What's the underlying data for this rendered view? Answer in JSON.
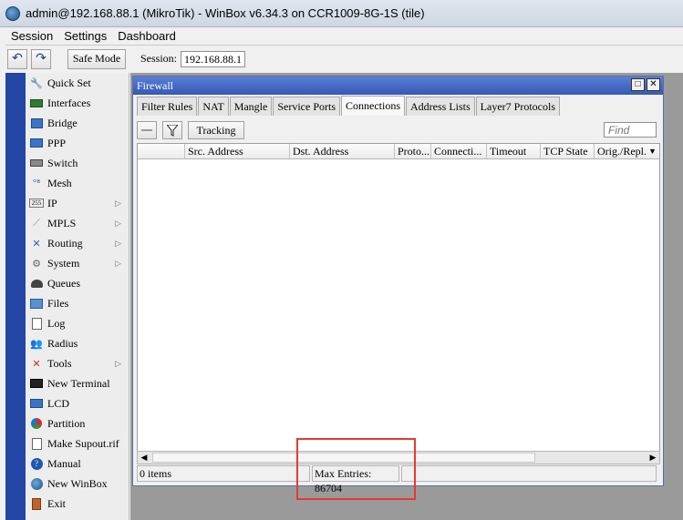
{
  "window": {
    "title": "admin@192.168.88.1 (MikroTik) - WinBox v6.34.3 on CCR1009-8G-1S (tile)"
  },
  "menu": {
    "items": [
      "Session",
      "Settings",
      "Dashboard"
    ]
  },
  "toolbar": {
    "undo_icon": "undo-icon",
    "redo_icon": "redo-icon",
    "safe_mode": "Safe Mode",
    "session_label": "Session:",
    "session_value": "192.168.88.1"
  },
  "sidebar": {
    "items": [
      {
        "label": "Quick Set",
        "icon": "quick-set-icon",
        "arrow": false
      },
      {
        "label": "Interfaces",
        "icon": "interfaces-icon",
        "arrow": false
      },
      {
        "label": "Bridge",
        "icon": "bridge-icon",
        "arrow": false
      },
      {
        "label": "PPP",
        "icon": "ppp-icon",
        "arrow": false
      },
      {
        "label": "Switch",
        "icon": "switch-icon",
        "arrow": false
      },
      {
        "label": "Mesh",
        "icon": "mesh-icon",
        "arrow": false
      },
      {
        "label": "IP",
        "icon": "ip-icon",
        "arrow": true
      },
      {
        "label": "MPLS",
        "icon": "mpls-icon",
        "arrow": true
      },
      {
        "label": "Routing",
        "icon": "routing-icon",
        "arrow": true
      },
      {
        "label": "System",
        "icon": "system-icon",
        "arrow": true
      },
      {
        "label": "Queues",
        "icon": "queues-icon",
        "arrow": false
      },
      {
        "label": "Files",
        "icon": "files-icon",
        "arrow": false
      },
      {
        "label": "Log",
        "icon": "log-icon",
        "arrow": false
      },
      {
        "label": "Radius",
        "icon": "radius-icon",
        "arrow": false
      },
      {
        "label": "Tools",
        "icon": "tools-icon",
        "arrow": true
      },
      {
        "label": "New Terminal",
        "icon": "terminal-icon",
        "arrow": false
      },
      {
        "label": "LCD",
        "icon": "lcd-icon",
        "arrow": false
      },
      {
        "label": "Partition",
        "icon": "partition-icon",
        "arrow": false
      },
      {
        "label": "Make Supout.rif",
        "icon": "supout-icon",
        "arrow": false
      },
      {
        "label": "Manual",
        "icon": "manual-icon",
        "arrow": false
      },
      {
        "label": "New WinBox",
        "icon": "winbox-icon",
        "arrow": false
      },
      {
        "label": "Exit",
        "icon": "exit-icon",
        "arrow": false
      }
    ]
  },
  "firewall": {
    "title": "Firewall",
    "tabs": [
      {
        "label": "Filter Rules",
        "active": false
      },
      {
        "label": "NAT",
        "active": false
      },
      {
        "label": "Mangle",
        "active": false
      },
      {
        "label": "Service Ports",
        "active": false
      },
      {
        "label": "Connections",
        "active": true
      },
      {
        "label": "Address Lists",
        "active": false
      },
      {
        "label": "Layer7 Protocols",
        "active": false
      }
    ],
    "tracking_label": "Tracking",
    "find_placeholder": "Find",
    "columns": [
      "",
      "Src. Address",
      "Dst. Address",
      "Proto...",
      "Connecti...",
      "Timeout",
      "TCP State",
      "Orig./Repl."
    ],
    "status_items": "0 items",
    "status_max": "Max Entries: 86704"
  },
  "colors": {
    "sidebar_strip": "#2346a4",
    "window_title": "#3d63c0",
    "highlight": "#e53935"
  }
}
